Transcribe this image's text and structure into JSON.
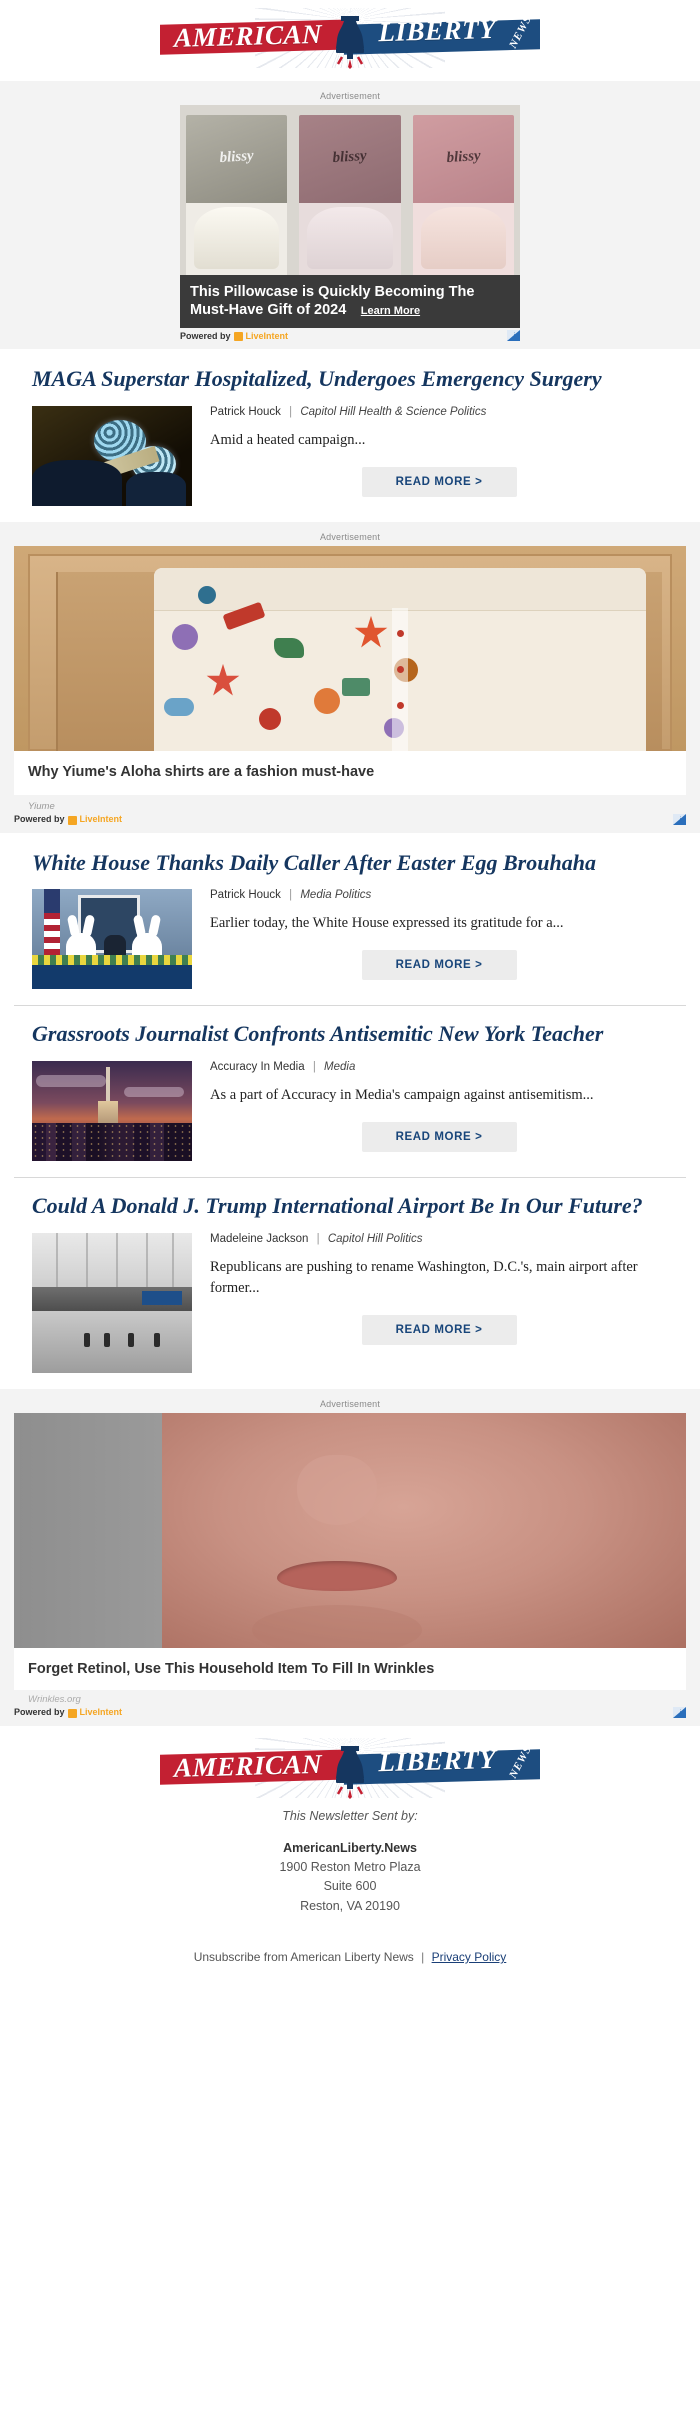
{
  "brand": {
    "logo_word_left": "AMERICAN",
    "logo_word_right": "LIBERTY",
    "logo_sub": "NEWS",
    "color_red": "#c32032",
    "color_blue": "#1d4d80",
    "headline_color": "#15365f"
  },
  "ads": [
    {
      "label": "Advertisement",
      "brand_on_box": "blissy",
      "headline": "This Pillowcase is Quickly Becoming The Must-Have Gift of 2024",
      "cta": "Learn More",
      "powered_prefix": "Powered by",
      "powered_network": "LiveIntent",
      "adchoices_icon": "adchoices-icon"
    },
    {
      "label": "Advertisement",
      "headline": "Why Yiume's Aloha shirts are a fashion must-have",
      "brand": "Yiume",
      "powered_prefix": "Powered by",
      "powered_network": "LiveIntent",
      "adchoices_icon": "adchoices-icon"
    },
    {
      "label": "Advertisement",
      "headline": "Forget Retinol, Use This Household Item To Fill In Wrinkles",
      "brand": "Wrinkles.org",
      "powered_prefix": "Powered by",
      "powered_network": "LiveIntent",
      "adchoices_icon": "adchoices-icon"
    }
  ],
  "articles": [
    {
      "title": "MAGA Superstar Hospitalized, Undergoes Emergency Surgery",
      "author": "Patrick Houck",
      "separator": "|",
      "category": "Capitol Hill Health & Science Politics",
      "excerpt": "Amid a heated campaign...",
      "read_more": "READ MORE >",
      "image_name": "operating-room-photo"
    },
    {
      "title": "White House Thanks Daily Caller After Easter Egg Brouhaha",
      "author": "Patrick Houck",
      "separator": "|",
      "category": "Media Politics",
      "excerpt": "Earlier today, the White House expressed its gratitude for a...",
      "read_more": "READ MORE >",
      "image_name": "white-house-easter-bunnies-photo"
    },
    {
      "title": "Grassroots Journalist Confronts Antisemitic New York Teacher",
      "author": "Accuracy In Media",
      "separator": "|",
      "category": "Media",
      "excerpt": "As a part of Accuracy in Media's campaign against antisemitism...",
      "read_more": "READ MORE >",
      "image_name": "new-york-skyline-photo"
    },
    {
      "title": "Could A Donald J. Trump International Airport Be In Our Future?",
      "author": "Madeleine Jackson",
      "separator": "|",
      "category": "Capitol Hill Politics",
      "excerpt": "Republicans are pushing to rename Washington, D.C.'s, main airport after former...",
      "read_more": "READ MORE >",
      "image_name": "airport-terminal-photo"
    }
  ],
  "footer": {
    "sent_by": "This Newsletter Sent by:",
    "brand": "AmericanLiberty.News",
    "address_line1": "1900 Reston Metro Plaza",
    "address_line2": "Suite 600",
    "address_line3": "Reston, VA 20190",
    "unsubscribe": "Unsubscribe from American Liberty News",
    "divider": "|",
    "privacy": "Privacy Policy"
  }
}
